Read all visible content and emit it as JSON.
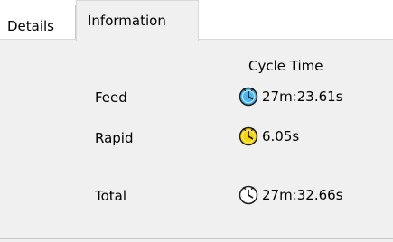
{
  "tabs": {
    "details_label": "Details",
    "information_label": "Information"
  },
  "cycle": {
    "header": "Cycle Time",
    "rows": [
      {
        "label": "Feed",
        "value": "27m:23.61s",
        "icon": "clock-blue-icon",
        "color": "#4ab6ef"
      },
      {
        "label": "Rapid",
        "value": "6.05s",
        "icon": "clock-yellow-icon",
        "color": "#f6d40a"
      },
      {
        "label": "Total",
        "value": "27m:32.66s",
        "icon": "clock-white-icon",
        "color": "#ffffff"
      }
    ]
  },
  "colors": {
    "panel_bg": "#f0f0f0",
    "tab_border": "#d9d9d9"
  }
}
